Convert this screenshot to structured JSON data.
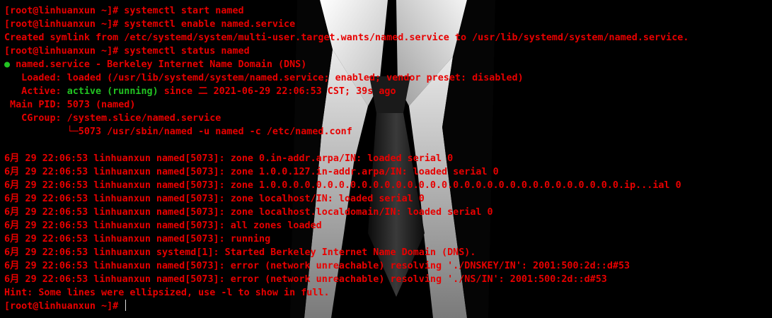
{
  "terminal": {
    "prompt": "[root@linhuanxun ~]# ",
    "lines": [
      "[root@linhuanxun ~]# systemctl start named",
      "[root@linhuanxun ~]# systemctl enable named.service",
      "Created symlink from /etc/systemd/system/multi-user.target.wants/named.service to /usr/lib/systemd/system/named.service.",
      "[root@linhuanxun ~]# systemctl status named",
      {
        "dot": "●",
        "text": " named.service - Berkeley Internet Name Domain (DNS)"
      },
      "   Loaded: loaded (/usr/lib/systemd/system/named.service; enabled; vendor preset: disabled)",
      {
        "pre": "   Active: ",
        "green": "active (running)",
        "post": " since 二 2021-06-29 22:06:53 CST; 39s ago"
      },
      " Main PID: 5073 (named)",
      "   CGroup: /system.slice/named.service",
      "           └─5073 /usr/sbin/named -u named -c /etc/named.conf",
      "",
      "6月 29 22:06:53 linhuanxun named[5073]: zone 0.in-addr.arpa/IN: loaded serial 0",
      "6月 29 22:06:53 linhuanxun named[5073]: zone 1.0.0.127.in-addr.arpa/IN: loaded serial 0",
      "6月 29 22:06:53 linhuanxun named[5073]: zone 1.0.0.0.0.0.0.0.0.0.0.0.0.0.0.0.0.0.0.0.0.0.0.0.0.0.0.0.0.0.0.0.ip...ial 0",
      "6月 29 22:06:53 linhuanxun named[5073]: zone localhost/IN: loaded serial 0",
      "6月 29 22:06:53 linhuanxun named[5073]: zone localhost.localdomain/IN: loaded serial 0",
      "6月 29 22:06:53 linhuanxun named[5073]: all zones loaded",
      "6月 29 22:06:53 linhuanxun named[5073]: running",
      "6月 29 22:06:53 linhuanxun systemd[1]: Started Berkeley Internet Name Domain (DNS).",
      "6月 29 22:06:53 linhuanxun named[5073]: error (network unreachable) resolving './DNSKEY/IN': 2001:500:2d::d#53",
      "6月 29 22:06:53 linhuanxun named[5073]: error (network unreachable) resolving './NS/IN': 2001:500:2d::d#53",
      "Hint: Some lines were ellipsized, use -l to show in full."
    ]
  },
  "colors": {
    "background": "#000000",
    "text": "#e80000",
    "active": "#22c322",
    "cursor": "#dcdcdc"
  },
  "wallpaper": {
    "subject": "white-collar-black-tie-figure"
  }
}
